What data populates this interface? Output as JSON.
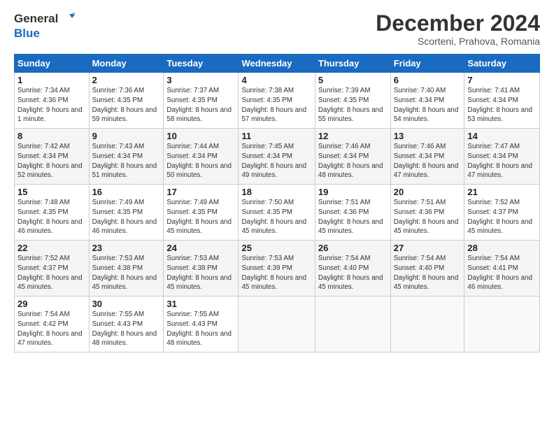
{
  "logo": {
    "line1": "General",
    "line2": "Blue"
  },
  "title": "December 2024",
  "subtitle": "Scorteni, Prahova, Romania",
  "days_header": [
    "Sunday",
    "Monday",
    "Tuesday",
    "Wednesday",
    "Thursday",
    "Friday",
    "Saturday"
  ],
  "weeks": [
    [
      {
        "num": "1",
        "sunrise": "7:34 AM",
        "sunset": "4:36 PM",
        "daylight": "9 hours and 1 minute."
      },
      {
        "num": "2",
        "sunrise": "7:36 AM",
        "sunset": "4:35 PM",
        "daylight": "8 hours and 59 minutes."
      },
      {
        "num": "3",
        "sunrise": "7:37 AM",
        "sunset": "4:35 PM",
        "daylight": "8 hours and 58 minutes."
      },
      {
        "num": "4",
        "sunrise": "7:38 AM",
        "sunset": "4:35 PM",
        "daylight": "8 hours and 57 minutes."
      },
      {
        "num": "5",
        "sunrise": "7:39 AM",
        "sunset": "4:35 PM",
        "daylight": "8 hours and 55 minutes."
      },
      {
        "num": "6",
        "sunrise": "7:40 AM",
        "sunset": "4:34 PM",
        "daylight": "8 hours and 54 minutes."
      },
      {
        "num": "7",
        "sunrise": "7:41 AM",
        "sunset": "4:34 PM",
        "daylight": "8 hours and 53 minutes."
      }
    ],
    [
      {
        "num": "8",
        "sunrise": "7:42 AM",
        "sunset": "4:34 PM",
        "daylight": "8 hours and 52 minutes."
      },
      {
        "num": "9",
        "sunrise": "7:43 AM",
        "sunset": "4:34 PM",
        "daylight": "8 hours and 51 minutes."
      },
      {
        "num": "10",
        "sunrise": "7:44 AM",
        "sunset": "4:34 PM",
        "daylight": "8 hours and 50 minutes."
      },
      {
        "num": "11",
        "sunrise": "7:45 AM",
        "sunset": "4:34 PM",
        "daylight": "8 hours and 49 minutes."
      },
      {
        "num": "12",
        "sunrise": "7:46 AM",
        "sunset": "4:34 PM",
        "daylight": "8 hours and 48 minutes."
      },
      {
        "num": "13",
        "sunrise": "7:46 AM",
        "sunset": "4:34 PM",
        "daylight": "8 hours and 47 minutes."
      },
      {
        "num": "14",
        "sunrise": "7:47 AM",
        "sunset": "4:34 PM",
        "daylight": "8 hours and 47 minutes."
      }
    ],
    [
      {
        "num": "15",
        "sunrise": "7:48 AM",
        "sunset": "4:35 PM",
        "daylight": "8 hours and 46 minutes."
      },
      {
        "num": "16",
        "sunrise": "7:49 AM",
        "sunset": "4:35 PM",
        "daylight": "8 hours and 46 minutes."
      },
      {
        "num": "17",
        "sunrise": "7:49 AM",
        "sunset": "4:35 PM",
        "daylight": "8 hours and 45 minutes."
      },
      {
        "num": "18",
        "sunrise": "7:50 AM",
        "sunset": "4:35 PM",
        "daylight": "8 hours and 45 minutes."
      },
      {
        "num": "19",
        "sunrise": "7:51 AM",
        "sunset": "4:36 PM",
        "daylight": "8 hours and 45 minutes."
      },
      {
        "num": "20",
        "sunrise": "7:51 AM",
        "sunset": "4:36 PM",
        "daylight": "8 hours and 45 minutes."
      },
      {
        "num": "21",
        "sunrise": "7:52 AM",
        "sunset": "4:37 PM",
        "daylight": "8 hours and 45 minutes."
      }
    ],
    [
      {
        "num": "22",
        "sunrise": "7:52 AM",
        "sunset": "4:37 PM",
        "daylight": "8 hours and 45 minutes."
      },
      {
        "num": "23",
        "sunrise": "7:53 AM",
        "sunset": "4:38 PM",
        "daylight": "8 hours and 45 minutes."
      },
      {
        "num": "24",
        "sunrise": "7:53 AM",
        "sunset": "4:38 PM",
        "daylight": "8 hours and 45 minutes."
      },
      {
        "num": "25",
        "sunrise": "7:53 AM",
        "sunset": "4:39 PM",
        "daylight": "8 hours and 45 minutes."
      },
      {
        "num": "26",
        "sunrise": "7:54 AM",
        "sunset": "4:40 PM",
        "daylight": "8 hours and 45 minutes."
      },
      {
        "num": "27",
        "sunrise": "7:54 AM",
        "sunset": "4:40 PM",
        "daylight": "8 hours and 45 minutes."
      },
      {
        "num": "28",
        "sunrise": "7:54 AM",
        "sunset": "4:41 PM",
        "daylight": "8 hours and 46 minutes."
      }
    ],
    [
      {
        "num": "29",
        "sunrise": "7:54 AM",
        "sunset": "4:42 PM",
        "daylight": "8 hours and 47 minutes."
      },
      {
        "num": "30",
        "sunrise": "7:55 AM",
        "sunset": "4:43 PM",
        "daylight": "8 hours and 48 minutes."
      },
      {
        "num": "31",
        "sunrise": "7:55 AM",
        "sunset": "4:43 PM",
        "daylight": "8 hours and 48 minutes."
      },
      null,
      null,
      null,
      null
    ]
  ]
}
